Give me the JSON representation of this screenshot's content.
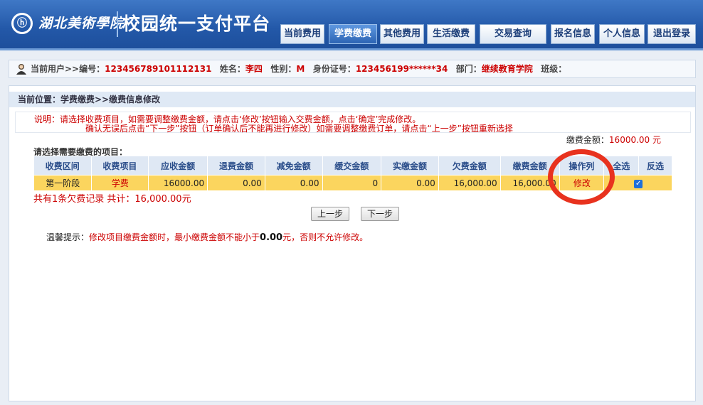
{
  "header": {
    "logo_glyph": "ⓗ",
    "school_name": "湖北美術學院",
    "platform_title": "校园统一支付平台",
    "nav": [
      "当前费用",
      "学费缴费",
      "其他费用",
      "生活缴费",
      "交易查询",
      "报名信息",
      "个人信息",
      "退出登录"
    ],
    "active_nav": "学费缴费"
  },
  "userbar": {
    "prefix": "当前用户>>",
    "id_label": "编号：",
    "id_value": "123456789101112131",
    "name_label": "姓名：",
    "name_value": "李四",
    "sex_label": "性别：",
    "sex_value": "M",
    "idcard_label": "身份证号：",
    "idcard_value": "123456199******34",
    "dept_label": "部门：",
    "dept_value": "继续教育学院",
    "class_label": "班级：",
    "class_value": ""
  },
  "main": {
    "breadcrumb": "当前位置：学费缴费>>缴费信息修改",
    "note_line1": "说明：请选择收费项目，如需要调整缴费金额，请点击‘修改’按钮输入交费金额，点击‘确定’完成修改。",
    "note_line2": "确认无误后点击“下一步”按钮（订单确认后不能再进行修改）如需要调整缴费订单，请点击“上一步”按钮重新选择",
    "amount_label": "缴费金额：",
    "amount_value": "16000.00 元",
    "choose_prompt": "请选择需要缴费的项目："
  },
  "table": {
    "headers": [
      "收费区间",
      "收费项目",
      "应收金额",
      "退费金额",
      "减免金额",
      "缓交金额",
      "实缴金额",
      "欠费金额",
      "缴费金额",
      "操作列",
      "全选",
      "反选"
    ],
    "row": {
      "period": "第一阶段",
      "item": "学费",
      "receivable": "16000.00",
      "refund": "0.00",
      "reduction": "0.00",
      "deferred": "0",
      "paid": "0.00",
      "owed": "16,000.00",
      "pay_amount": "16,000.00",
      "action": "修改",
      "checked": true
    }
  },
  "summary": "共有1条欠费记录  共计：16,000.00元",
  "buttons": {
    "prev": "上一步",
    "next": "下一步"
  },
  "tip": {
    "label": "温馨提示：",
    "text_a": "修改项目缴费金额时，最小缴费金额不能小于",
    "min_value": "0.00",
    "text_b": "元，否则不允许修改。"
  },
  "colors": {
    "header_blue": "#2358a8",
    "row_highlight": "#fbd55e",
    "alert_red": "#c00000",
    "annotation_circle": "#e8321e"
  }
}
